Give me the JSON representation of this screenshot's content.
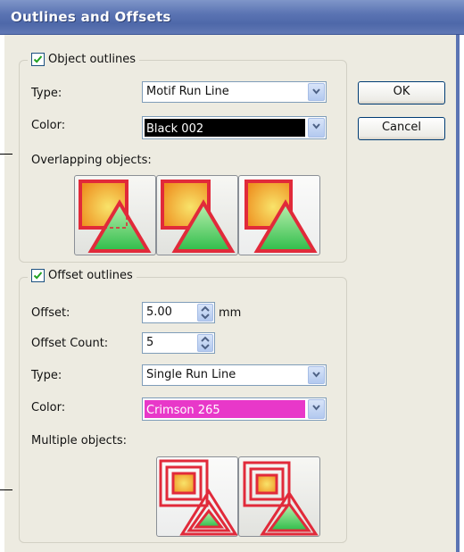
{
  "window": {
    "title": "Outlines and Offsets"
  },
  "buttons": {
    "ok": "OK",
    "cancel": "Cancel"
  },
  "object_outlines": {
    "label": "Object outlines",
    "checked": true,
    "type_label": "Type:",
    "type_value": "Motif Run Line",
    "color_label": "Color:",
    "color_value": "Black 002",
    "color_swatch": "#000000",
    "overlap_label": "Overlapping objects:",
    "overlap_options": [
      "overlap-mode-1",
      "overlap-mode-2",
      "overlap-mode-3"
    ]
  },
  "offset_outlines": {
    "label": "Offset outlines",
    "checked": true,
    "offset_label": "Offset:",
    "offset_value": "5.00",
    "offset_unit": "mm",
    "count_label": "Offset Count:",
    "count_value": "5",
    "type_label": "Type:",
    "type_value": "Single Run Line",
    "color_label": "Color:",
    "color_value": "Crimson 265",
    "color_swatch": "#e838c9",
    "multiple_label": "Multiple objects:",
    "multiple_options": [
      "multiple-mode-1",
      "multiple-mode-2"
    ]
  }
}
